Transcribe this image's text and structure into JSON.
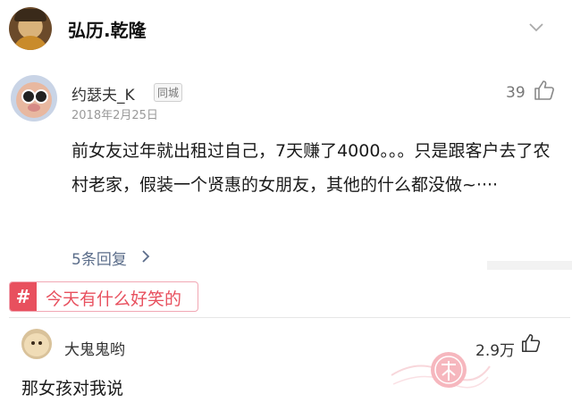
{
  "header": {
    "title": "弘历.乾隆"
  },
  "comment1": {
    "username": "约瑟夫_K",
    "badge": "同城",
    "date": "2018年2月25日",
    "likes": "39",
    "text": "前女友过年就出租过自己，7天赚了4000。。。只是跟客户去了农村老家，假装一个贤惠的女朋友，其他的什么都没做~····",
    "replies_label": "5条回复"
  },
  "topic": {
    "hash": "#",
    "label": "今天有什么好笑的"
  },
  "comment2": {
    "username": "大鬼鬼哟",
    "likes": "2.9万",
    "text": "那女孩对我说"
  },
  "colors": {
    "accent": "#e8505e",
    "reply_link": "#5b6d8a"
  },
  "icons": {
    "header_right": "chevron-down-icon",
    "like": "thumbs-up-icon",
    "replies": "chevron-right-icon"
  }
}
